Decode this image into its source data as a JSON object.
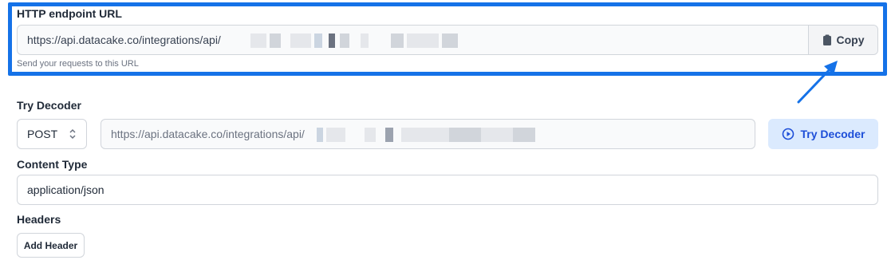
{
  "endpoint": {
    "label": "HTTP endpoint URL",
    "url_prefix": "https://api.datacake.co/integrations/api/",
    "copy_label": "Copy",
    "hint": "Send your requests to this URL"
  },
  "decoder": {
    "label": "Try Decoder",
    "method": "POST",
    "url_prefix": "https://api.datacake.co/integrations/api/",
    "button_label": "Try Decoder"
  },
  "content_type": {
    "label": "Content Type",
    "value": "application/json"
  },
  "headers": {
    "label": "Headers",
    "add_label": "Add Header"
  },
  "colors": {
    "highlight": "#1572e8",
    "primary_button_bg": "#dbeafe",
    "primary_button_text": "#1d4ed8"
  }
}
